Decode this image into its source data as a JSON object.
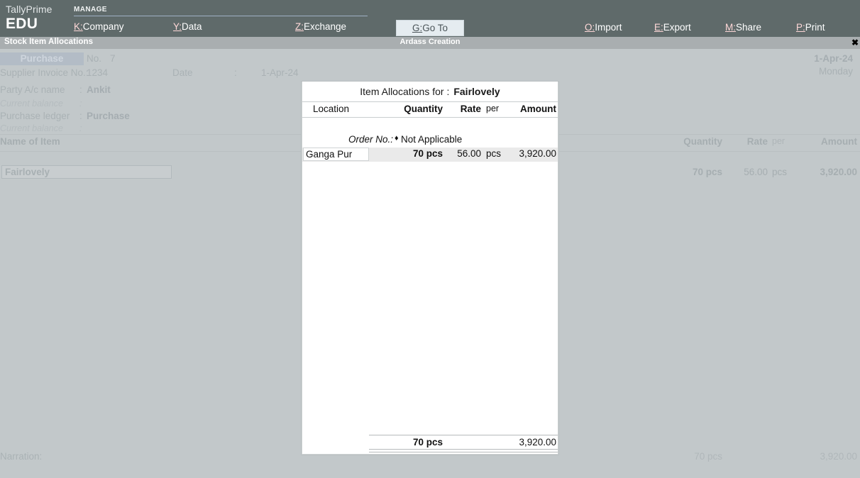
{
  "app": {
    "brand_name": "TallyPrime",
    "brand_edition": "EDU"
  },
  "topbar": {
    "group_title": "MANAGE",
    "menu": [
      {
        "hotkey": "K:",
        "label": "Company"
      },
      {
        "hotkey": "Y:",
        "label": "Data"
      },
      {
        "hotkey": "Z:",
        "label": "Exchange"
      }
    ],
    "goto": {
      "hotkey": "G:",
      "label": "Go To"
    },
    "actions": [
      {
        "hotkey": "O:",
        "label": "Import"
      },
      {
        "hotkey": "E:",
        "label": "Export"
      },
      {
        "hotkey": "M:",
        "label": "Share"
      },
      {
        "hotkey": "P:",
        "label": "Print"
      }
    ]
  },
  "titlebar": {
    "screen": "Stock Item Allocations",
    "company": "Ardass Creation",
    "close_glyph": "✖"
  },
  "voucher": {
    "voucher_type": "Purchase",
    "no_label": "No.",
    "no_value": "7",
    "supplier_invoice_label": "Supplier Invoice No.:",
    "supplier_invoice_value": "1234",
    "date_label": "Date",
    "colon": ":",
    "date_value": "1-Apr-24",
    "party_label": "Party A/c name",
    "party_value": "Ankit",
    "current_balance_label": "Current balance",
    "purchase_ledger_label": "Purchase ledger",
    "purchase_ledger_value": "Purchase",
    "top_date": "1-Apr-24",
    "top_day": "Monday",
    "columns": {
      "item": "Name of Item",
      "quantity": "Quantity",
      "rate": "Rate",
      "per": "per",
      "amount": "Amount"
    },
    "line": {
      "item": "Fairlovely",
      "quantity": "70 pcs",
      "rate": "56.00",
      "per": "pcs",
      "amount": "3,920.00"
    },
    "narration_label": "Narration:",
    "total_quantity": "70 pcs",
    "total_amount": "3,920.00"
  },
  "modal": {
    "title_prefix": "Item Allocations for :",
    "title_item": "Fairlovely",
    "columns": {
      "location": "Location",
      "quantity": "Quantity",
      "rate": "Rate",
      "per": "per",
      "amount": "Amount"
    },
    "order": {
      "label": "Order No.:",
      "marker": "♦",
      "value": "Not Applicable"
    },
    "rows": [
      {
        "location": "Ganga Pur",
        "quantity": "70 pcs",
        "rate": "56.00",
        "per": "pcs",
        "amount": "3,920.00"
      }
    ],
    "total": {
      "quantity": "70 pcs",
      "amount": "3,920.00"
    }
  },
  "colors": {
    "topbar_bg": "#5f6a6a",
    "titlebar_bg": "#a9aeb0",
    "voucher_dim_bg": "#c2c8ca",
    "hotkey": "#ffd8d8",
    "selection_row": "#eaeaea"
  }
}
